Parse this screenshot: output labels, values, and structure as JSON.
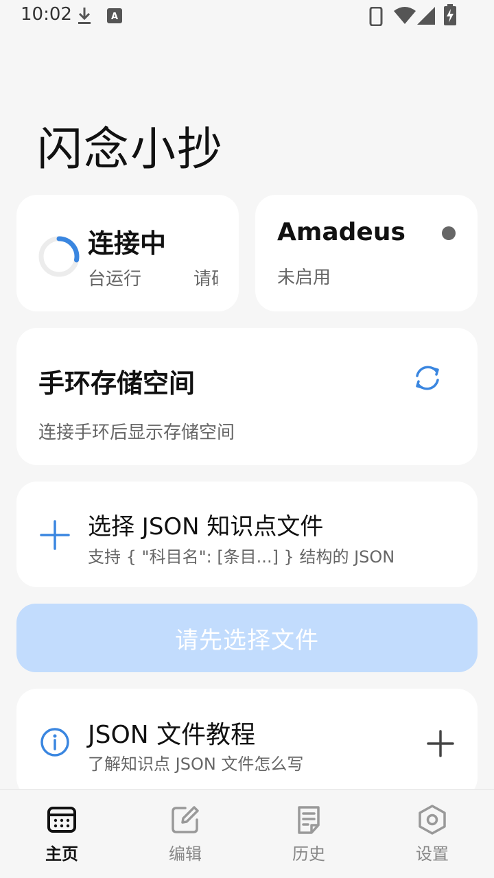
{
  "status_bar": {
    "time": "10:02"
  },
  "app": {
    "title": "闪念小抄"
  },
  "connection": {
    "title": "连接中",
    "subtitle_a": "后台运行",
    "subtitle_b": "请确"
  },
  "device": {
    "name": "Amadeus",
    "status": "未启用"
  },
  "storage": {
    "title": "手环存储空间",
    "description": "连接手环后显示存储空间"
  },
  "select_file": {
    "title": "选择 JSON 知识点文件",
    "subtitle": "支持 { \"科目名\": [条目...] } 结构的 JSON"
  },
  "primary_button": {
    "label": "请先选择文件"
  },
  "tutorial": {
    "title": "JSON 文件教程",
    "subtitle": "了解知识点 JSON 文件怎么写"
  },
  "nav": {
    "items": [
      {
        "label": "主页",
        "icon": "calendar-icon",
        "active": true
      },
      {
        "label": "编辑",
        "icon": "edit-icon",
        "active": false
      },
      {
        "label": "历史",
        "icon": "document-icon",
        "active": false
      },
      {
        "label": "设置",
        "icon": "settings-icon",
        "active": false
      }
    ]
  },
  "colors": {
    "accent": "#3a86e0",
    "disabled_button": "#c2dcfd",
    "background": "#f6f6f6"
  }
}
